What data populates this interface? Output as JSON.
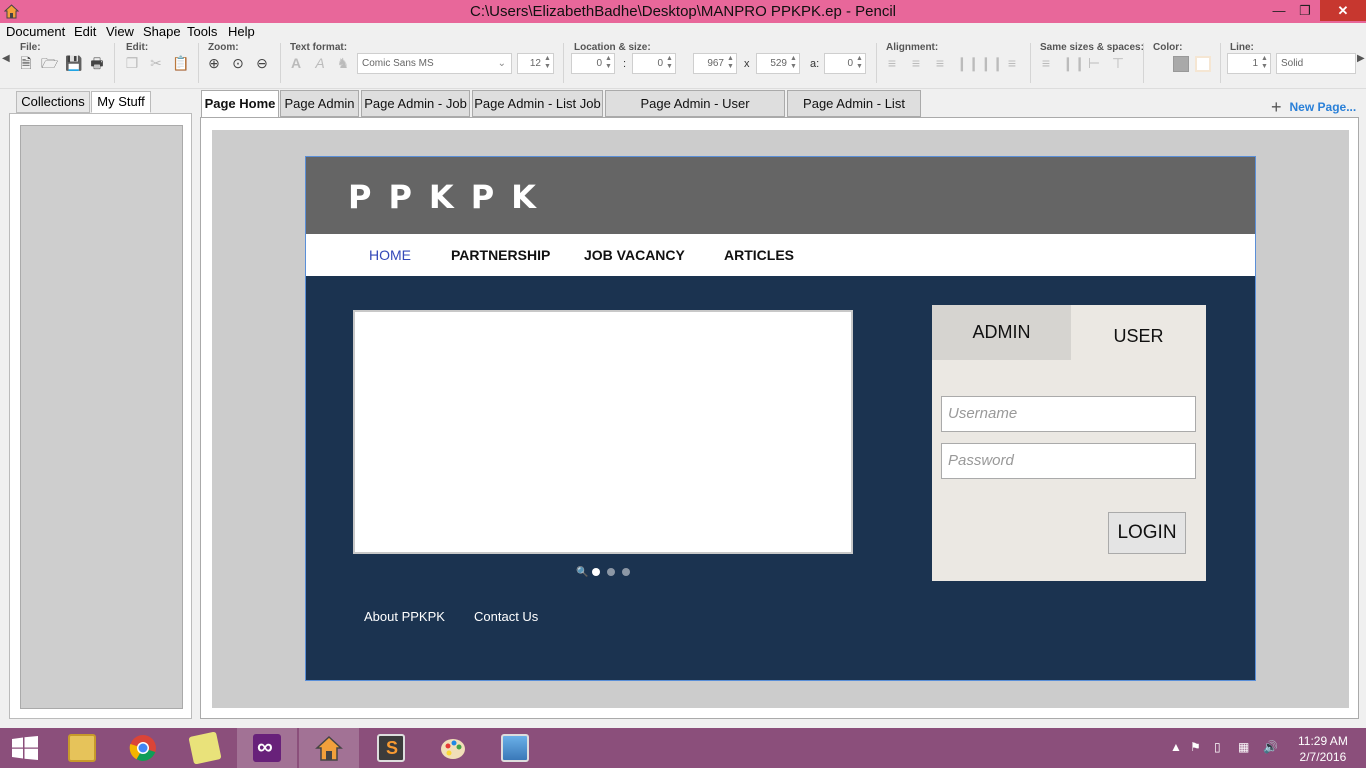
{
  "window": {
    "title": "C:\\Users\\ElizabethBadhe\\Desktop\\MANPRO PPKPK.ep - Pencil"
  },
  "menu": [
    "Document",
    "Edit",
    "View",
    "Shape",
    "Tools",
    "Help"
  ],
  "toolbar": {
    "labels": {
      "file": "File:",
      "edit": "Edit:",
      "zoom": "Zoom:",
      "text_format": "Text format:",
      "location_size": "Location & size:",
      "alignment": "Alignment:",
      "same_sizes": "Same sizes & spaces:",
      "color": "Color:",
      "line": "Line:"
    },
    "font_name": "Comic Sans MS",
    "font_size": "12",
    "x": "0",
    "y": "0",
    "colon": ":",
    "width": "967",
    "times": "x",
    "height": "529",
    "angle_label": "a:",
    "angle": "0",
    "line_width": "1",
    "line_style": "Solid",
    "fill_color": "#a9a9a9",
    "stroke_color": "#f5e6d3"
  },
  "left_tabs": [
    "Collections",
    "My Stuff"
  ],
  "page_tabs": [
    "Page Home",
    "Page Admin",
    "Page Admin - Job",
    "Page Admin - List Job",
    "Page Admin - User Registration",
    "Page Admin - List User"
  ],
  "new_page_label": "New Page...",
  "mockup": {
    "logo": "PPKPK",
    "nav": [
      "HOME",
      "PARTNERSHIP",
      "JOB VACANCY",
      "ARTICLES"
    ],
    "footer_links": [
      "About PPKPK",
      "Contact Us"
    ],
    "login": {
      "tab_admin": "ADMIN",
      "tab_user": "USER",
      "username_placeholder": "Username",
      "password_placeholder": "Password",
      "button": "LOGIN"
    },
    "colors": {
      "header": "#656565",
      "body": "#1b3350",
      "nav_active": "#3348b8"
    }
  },
  "taskbar": {
    "apps": [
      "start-button",
      "file-explorer",
      "chrome",
      "sticky-notes",
      "visual-studio",
      "pencil",
      "sublime-text",
      "paint",
      "photos"
    ],
    "time": "11:29 AM",
    "date": "2/7/2016"
  }
}
